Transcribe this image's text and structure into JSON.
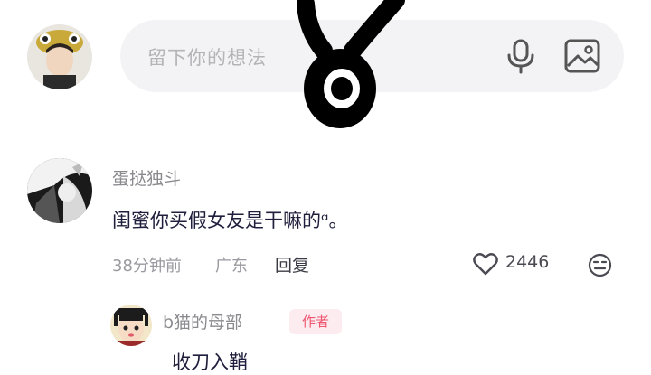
{
  "input": {
    "placeholder": "留下你的想法"
  },
  "comment": {
    "username": "蛋挞独斗",
    "text": "闺蜜你买假女友是干嘛的ᵅ。",
    "time": "38分钟前",
    "location": "广东",
    "reply_label": "回复",
    "like_count": "2446"
  },
  "reply": {
    "username": "b猫的母部",
    "badge": "作者",
    "text": "收刀入鞘"
  },
  "icons": {
    "mic": "microphone-icon",
    "image": "image-icon",
    "like": "heart-icon",
    "dislike": "dislike-face-icon"
  },
  "colors": {
    "background": "#ffffff",
    "input_bg": "#f3f3f5",
    "author_badge_bg": "#fdecef",
    "author_badge_text": "#f0556f",
    "muted_text": "#9a9aa0"
  }
}
